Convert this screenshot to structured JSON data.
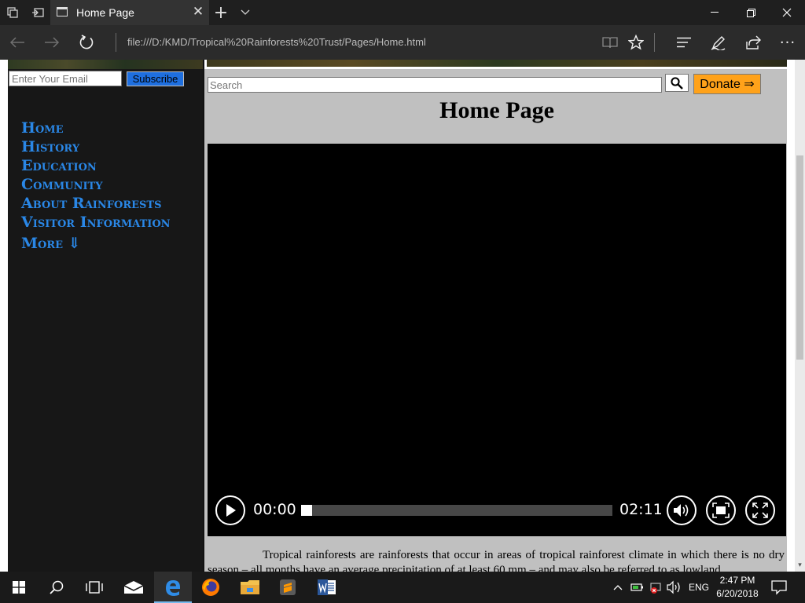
{
  "browser": {
    "tab_title": "Home Page",
    "address": "file:///D:/KMD/Tropical%20Rainforests%20Trust/Pages/Home.html",
    "window_buttons": [
      "minimize",
      "restore",
      "close"
    ],
    "icons": [
      "tab-set-aside-icon",
      "show-tabs-icon",
      "new-tab-icon",
      "tab-list-icon",
      "back-icon",
      "forward-icon",
      "refresh-icon",
      "reading-view-icon",
      "favorite-star-icon",
      "hub-icon",
      "notes-pen-icon",
      "share-icon",
      "more-icon"
    ]
  },
  "sidebar": {
    "email_placeholder": "Enter Your Email",
    "subscribe_label": "Subscribe",
    "nav": [
      {
        "label": "Home"
      },
      {
        "label": "History"
      },
      {
        "label": "Education"
      },
      {
        "label": "Community"
      },
      {
        "label": "About Rainforests"
      },
      {
        "label": "Visitor Information"
      },
      {
        "label": "More ⇓"
      }
    ],
    "link_color": "#2a87e6"
  },
  "header": {
    "search_placeholder": "Search",
    "donate_label": "Donate ⇒",
    "donate_color": "#ffa21a"
  },
  "main": {
    "title": "Home Page",
    "video": {
      "current_time": "00:00",
      "duration": "02:11",
      "progress": 0
    },
    "paragraph": "Tropical rainforests are rainforests that occur in areas of tropical rainforest climate in which there is no dry season – all months have an average precipitation of at least 60 mm – and may also be referred to as lowland"
  },
  "taskbar": {
    "apps": [
      "start-icon",
      "search-icon",
      "task-view-icon",
      "mail-icon",
      "edge-icon",
      "firefox-icon",
      "file-explorer-icon",
      "sublime-text-icon",
      "word-icon"
    ],
    "language": "ENG",
    "time": "2:47 PM",
    "date": "6/20/2018"
  }
}
